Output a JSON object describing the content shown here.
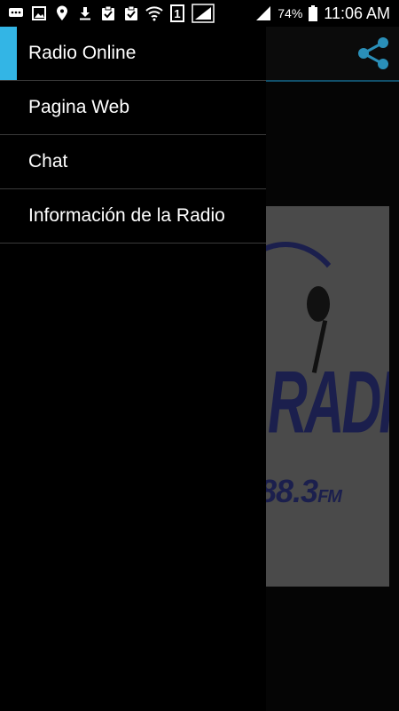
{
  "status_bar": {
    "icons": [
      "message-icon",
      "image-icon",
      "location-icon",
      "download-icon",
      "clipboard-check-icon",
      "clipboard-check-icon",
      "wifi-icon",
      "sim-1-icon",
      "signal-icon",
      "signal-icon",
      "battery-icon"
    ],
    "sim_label": "1",
    "battery_percent": "74%",
    "time": "11:06 AM"
  },
  "drawer": {
    "items": [
      {
        "label": "Radio Online",
        "active": true
      },
      {
        "label": "Pagina Web"
      },
      {
        "label": "Chat"
      },
      {
        "label": "Información de la Radio"
      }
    ]
  },
  "background": {
    "logo_radio": "RADIO",
    "logo_frequency": "88.3",
    "logo_fm": "FM"
  },
  "colors": {
    "accent": "#33b5e5",
    "background": "#000000",
    "share_icon": "#2a8fb8"
  }
}
